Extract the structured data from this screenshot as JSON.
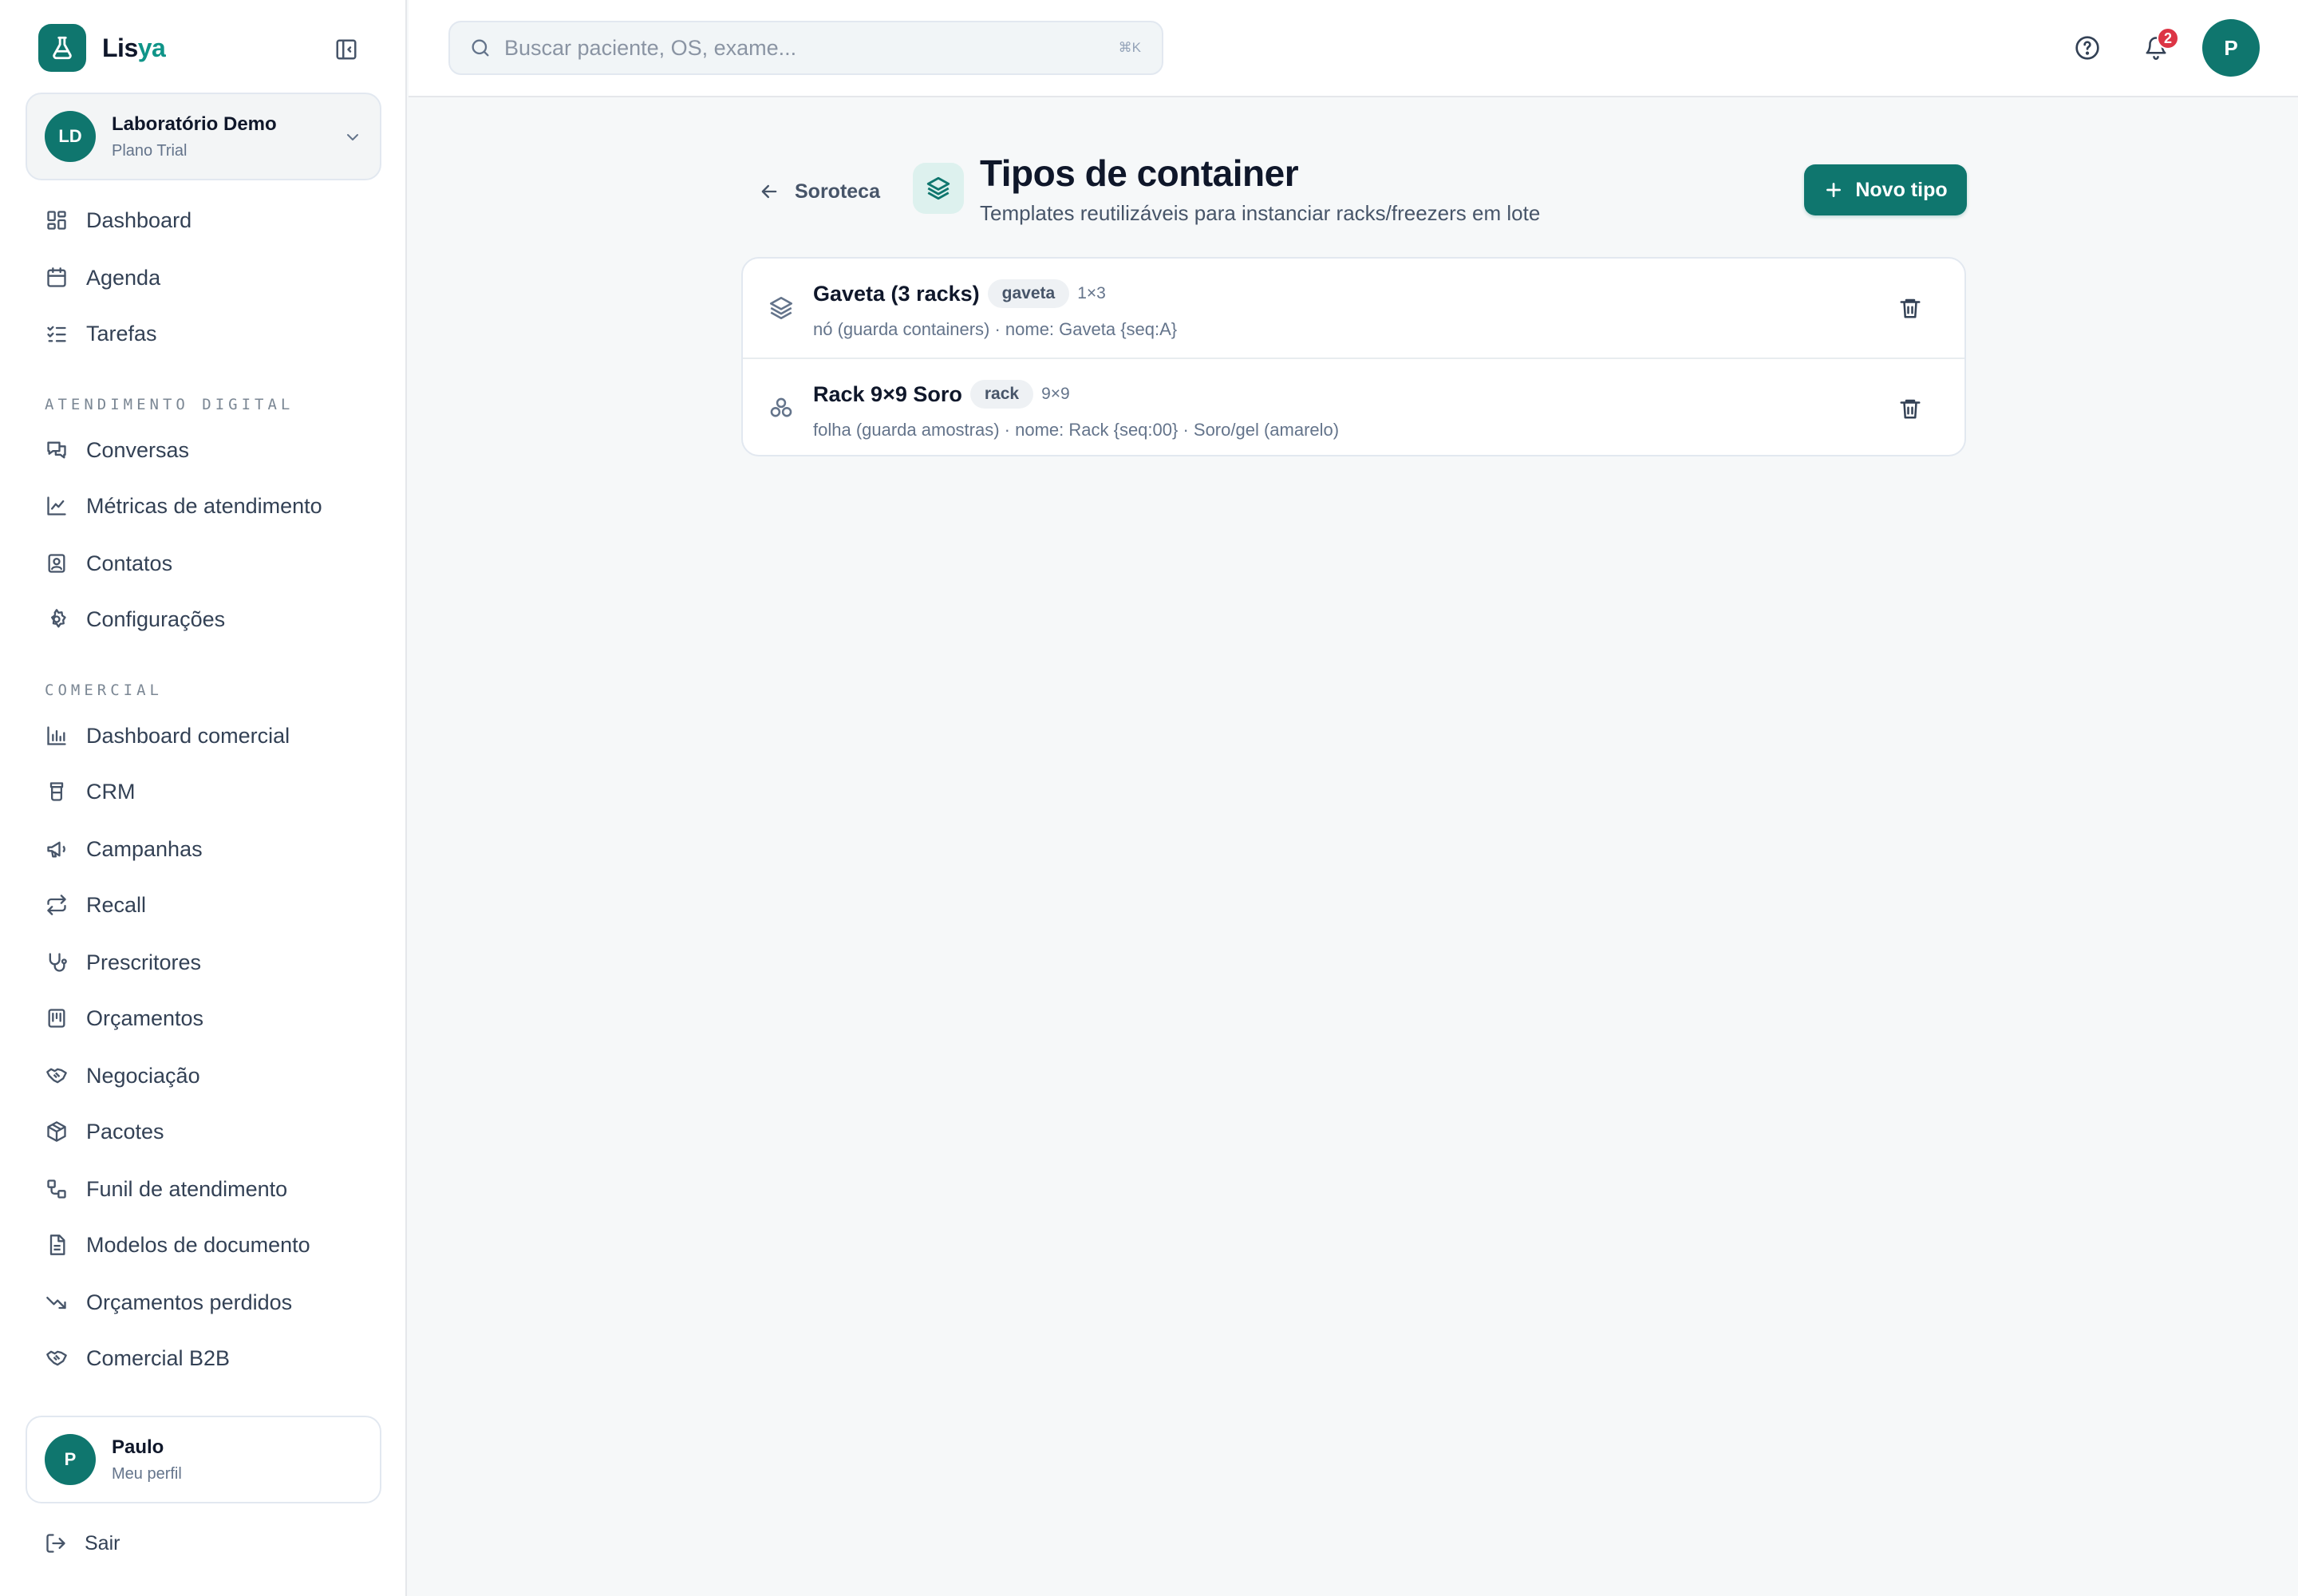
{
  "app": {
    "brand_prefix": "Lis",
    "brand_suffix": "ya"
  },
  "org": {
    "initials": "LD",
    "name": "Laboratório Demo",
    "plan": "Plano Trial"
  },
  "nav": {
    "main": [
      {
        "label": "Dashboard",
        "icon": "dashboard-icon"
      },
      {
        "label": "Agenda",
        "icon": "calendar-icon"
      },
      {
        "label": "Tarefas",
        "icon": "checklist-icon"
      }
    ],
    "section_digital": "ATENDIMENTO DIGITAL",
    "digital": [
      {
        "label": "Conversas",
        "icon": "chat-icon"
      },
      {
        "label": "Métricas de atendimento",
        "icon": "line-chart-icon"
      },
      {
        "label": "Contatos",
        "icon": "contact-icon"
      },
      {
        "label": "Configurações",
        "icon": "gear-icon"
      }
    ],
    "section_comercial": "COMERCIAL",
    "comercial": [
      {
        "label": "Dashboard comercial",
        "icon": "bar-chart-icon"
      },
      {
        "label": "CRM",
        "icon": "crm-icon"
      },
      {
        "label": "Campanhas",
        "icon": "megaphone-icon"
      },
      {
        "label": "Recall",
        "icon": "repeat-icon"
      },
      {
        "label": "Prescritores",
        "icon": "stethoscope-icon"
      },
      {
        "label": "Orçamentos",
        "icon": "receipt-icon"
      },
      {
        "label": "Negociação",
        "icon": "handshake-icon"
      },
      {
        "label": "Pacotes",
        "icon": "package-icon"
      },
      {
        "label": "Funil de atendimento",
        "icon": "funnel-icon"
      },
      {
        "label": "Modelos de documento",
        "icon": "document-icon"
      },
      {
        "label": "Orçamentos perdidos",
        "icon": "trending-down-icon"
      },
      {
        "label": "Comercial B2B",
        "icon": "handshake-icon"
      }
    ]
  },
  "profile": {
    "initial": "P",
    "name": "Paulo",
    "subtitle": "Meu perfil"
  },
  "logout_label": "Sair",
  "topbar": {
    "search_placeholder": "Buscar paciente, OS, exame...",
    "search_shortcut": "⌘K",
    "notification_count": "2",
    "user_initial": "P"
  },
  "page": {
    "back_label": "Soroteca",
    "title": "Tipos de container",
    "subtitle": "Templates reutilizáveis para instanciar racks/freezers em lote",
    "new_button": "Novo tipo"
  },
  "container_types": [
    {
      "name": "Gaveta (3 racks)",
      "badge": "gaveta",
      "dims": "1×3",
      "description": "nó (guarda containers) · nome: Gaveta {seq:A}",
      "icon": "layers-icon"
    },
    {
      "name": "Rack 9×9 Soro",
      "badge": "rack",
      "dims": "9×9",
      "description": "folha (guarda amostras) · nome: Rack {seq:00} · Soro/gel (amarelo)",
      "icon": "tubes-icon"
    }
  ],
  "colors": {
    "brand": "#0f766e",
    "brand_light": "#ddf1ee",
    "badge_red": "#dc3545",
    "background": "#f6f8f9"
  }
}
